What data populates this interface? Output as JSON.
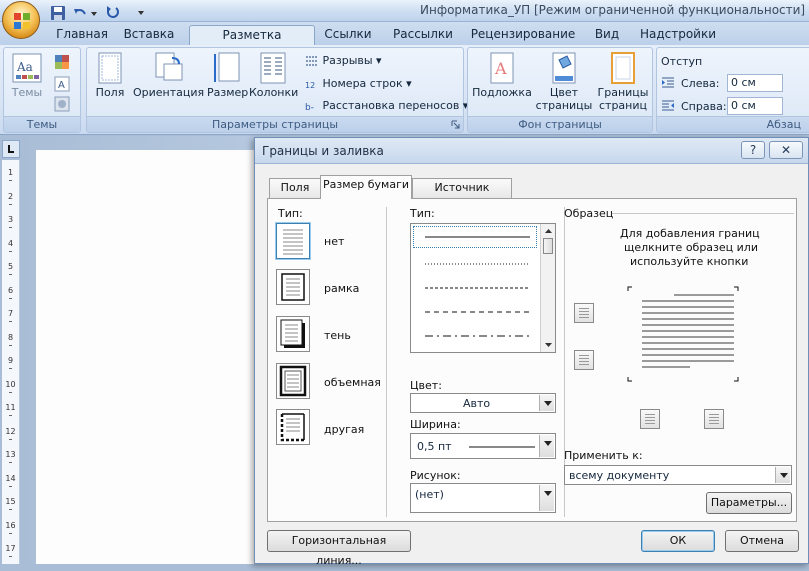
{
  "window": {
    "title": "Информатика_УП [Режим ограниченной функциональности] - Micro"
  },
  "ribbon_tabs": [
    "Главная",
    "Вставка",
    "Разметка страницы",
    "Ссылки",
    "Рассылки",
    "Рецензирование",
    "Вид",
    "Надстройки"
  ],
  "ribbon": {
    "themes": {
      "button": "Темы",
      "group": "Темы"
    },
    "page_setup": {
      "fields": "Поля",
      "orientation": "Ориентация",
      "size": "Размер",
      "columns": "Колонки",
      "breaks": "Разрывы",
      "line_numbers": "Номера строк",
      "hyphenation": "Расстановка переносов",
      "group": "Параметры страницы"
    },
    "background": {
      "watermark": "Подложка",
      "page_color_1": "Цвет",
      "page_color_2": "страницы",
      "page_borders_1": "Границы",
      "page_borders_2": "страниц",
      "group": "Фон страницы"
    },
    "indent": {
      "title": "Отступ",
      "left_label": "Слева:",
      "left_value": "0 см",
      "right_label": "Справа:",
      "right_value": "0 см",
      "group": "Абзац"
    }
  },
  "dialog": {
    "title": "Границы и заливка",
    "help": "?",
    "close": "✕",
    "tabs": [
      "Поля",
      "Размер бумаги",
      "Источник бумаги"
    ],
    "active_tab": "Размер бумаги",
    "type_label": "Тип:",
    "settings": [
      "нет",
      "рамка",
      "тень",
      "объемная",
      "другая"
    ],
    "style_label": "Тип:",
    "color_label": "Цвет:",
    "color_value": "Авто",
    "width_label": "Ширина:",
    "width_value": "0,5 пт",
    "art_label": "Рисунок:",
    "art_value": "(нет)",
    "preview_label": "Образец",
    "preview_hint_1": "Для добавления границ",
    "preview_hint_2": "щелкните образец или",
    "preview_hint_3": "используйте кнопки",
    "apply_label": "Применить к:",
    "apply_value": "всему документу",
    "options_button": "Параметры...",
    "horizontal_line_button": "Горизонтальная линия...",
    "ok_button": "ОК",
    "cancel_button": "Отмена"
  },
  "ruler": {
    "marks": [
      "1",
      "2",
      "3",
      "4",
      "5",
      "6",
      "7",
      "8",
      "9",
      "10",
      "11",
      "12",
      "13",
      "14",
      "15",
      "16",
      "17"
    ]
  }
}
